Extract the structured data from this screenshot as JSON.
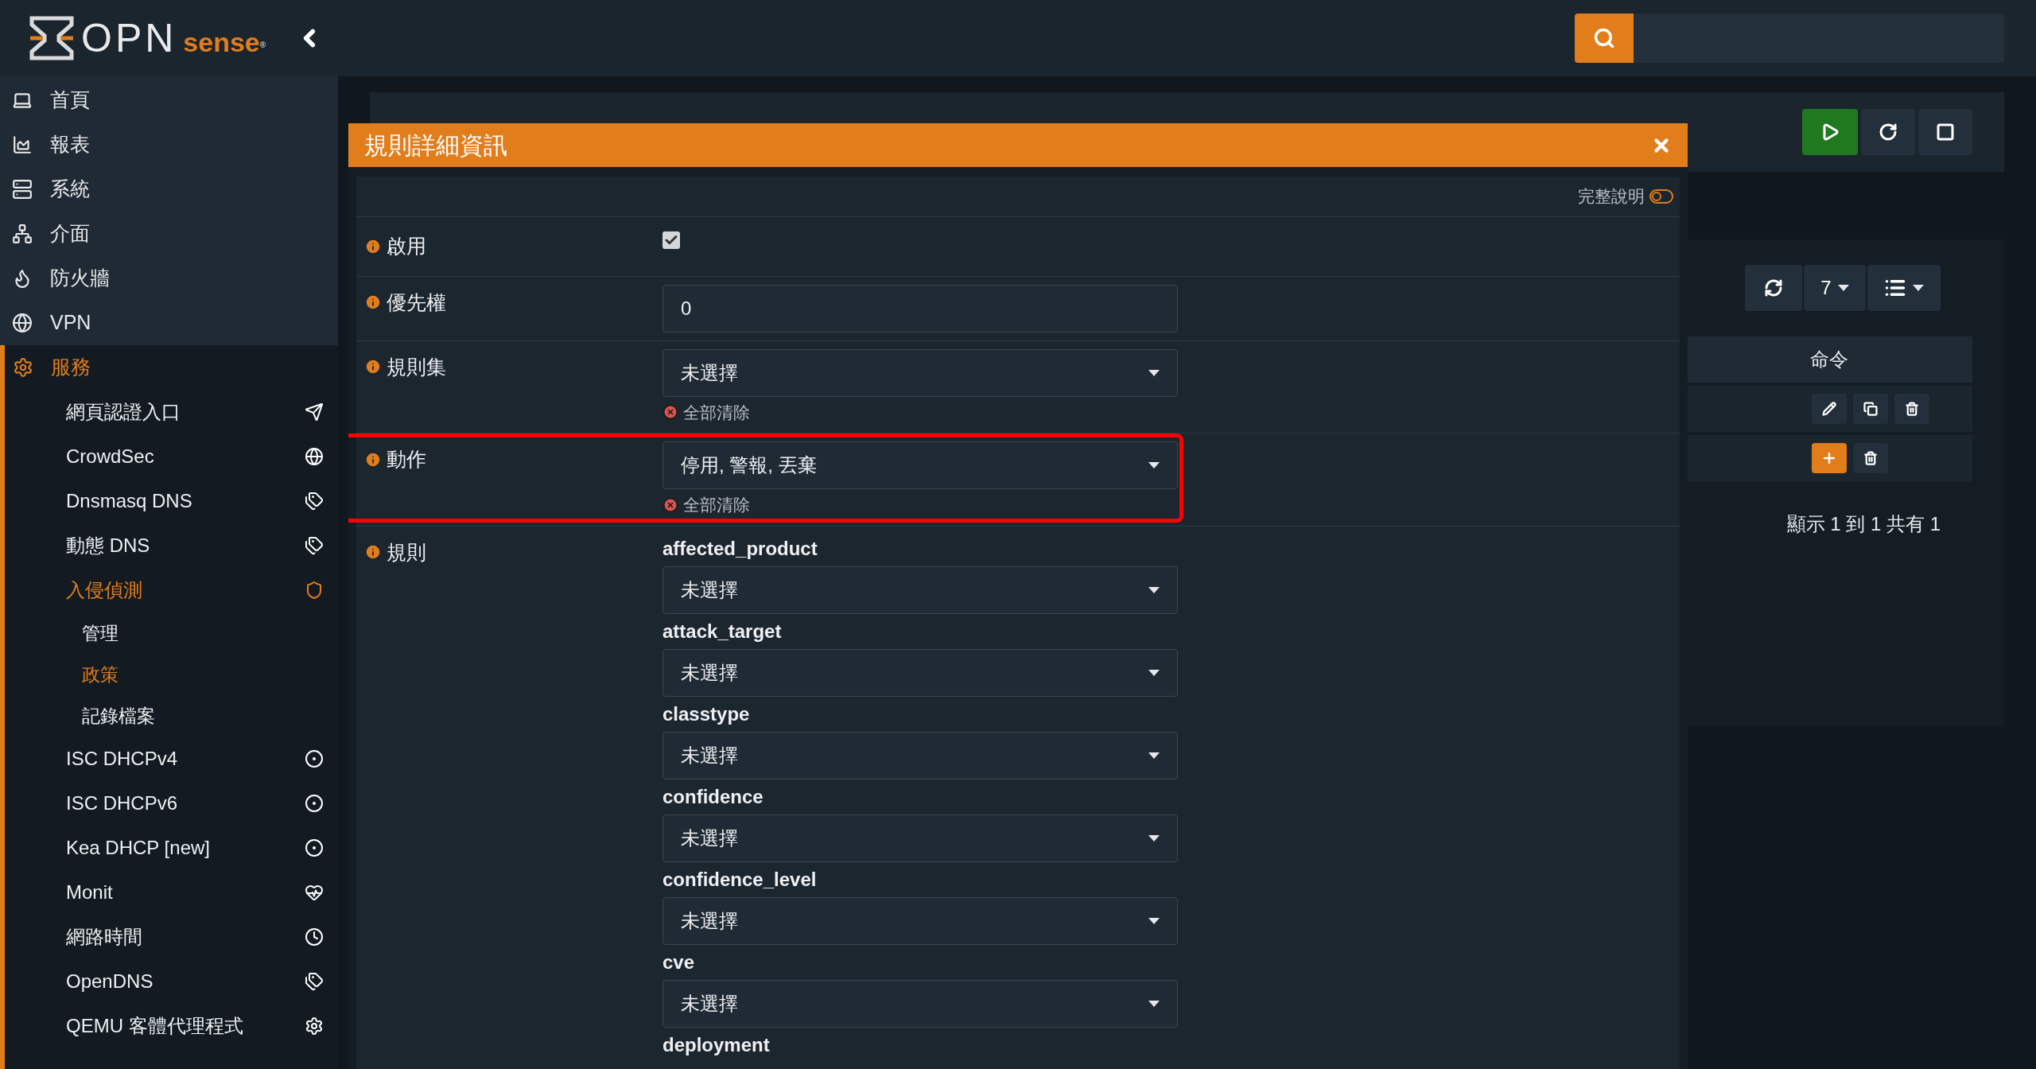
{
  "header": {
    "logo": {
      "main": "OPN",
      "accent": "sense",
      "mark": "®"
    }
  },
  "sidebar": {
    "items": [
      {
        "label": "首頁",
        "selected": false
      },
      {
        "label": "報表",
        "selected": false
      },
      {
        "label": "系統",
        "selected": false
      },
      {
        "label": "介面",
        "selected": false
      },
      {
        "label": "防火牆",
        "selected": false
      },
      {
        "label": "VPN",
        "selected": false
      },
      {
        "label": "服務",
        "selected": true,
        "children": [
          {
            "label": "網頁認證入口",
            "selected": false
          },
          {
            "label": "CrowdSec",
            "selected": false
          },
          {
            "label": "Dnsmasq DNS",
            "selected": false
          },
          {
            "label": "動態 DNS",
            "selected": false
          },
          {
            "label": "入侵偵測",
            "selected": true,
            "children": [
              {
                "label": "管理",
                "selected": false
              },
              {
                "label": "政策",
                "selected": true
              },
              {
                "label": "記錄檔案",
                "selected": false
              }
            ]
          },
          {
            "label": "ISC DHCPv4",
            "selected": false
          },
          {
            "label": "ISC DHCPv6",
            "selected": false
          },
          {
            "label": "Kea DHCP [new]",
            "selected": false
          },
          {
            "label": "Monit",
            "selected": false
          },
          {
            "label": "網路時間",
            "selected": false
          },
          {
            "label": "OpenDNS",
            "selected": false
          },
          {
            "label": "QEMU 客體代理程式",
            "selected": false
          }
        ]
      }
    ]
  },
  "page": {
    "table": {
      "page_size": "7",
      "columns": [
        "命令"
      ],
      "rows": [
        {
          "kind": "edit"
        },
        {
          "kind": "add"
        }
      ],
      "footer": "顯示 1 到 1 共有 1"
    }
  },
  "dialog": {
    "title": "規則詳細資訊",
    "full_help": {
      "label": "完整說明",
      "on": false
    },
    "fields": [
      {
        "kind": "checkbox",
        "label": "啟用",
        "checked": true,
        "highlighted": false
      },
      {
        "kind": "text",
        "label": "優先權",
        "value": "0",
        "highlighted": false
      },
      {
        "kind": "select",
        "label": "規則集",
        "value": "未選擇",
        "clear": "全部清除",
        "highlighted": false
      },
      {
        "kind": "select",
        "label": "動作",
        "value": "停用, 警報, 丟棄",
        "clear": "全部清除",
        "highlighted": true
      },
      {
        "kind": "group",
        "label": "規則",
        "highlighted": false,
        "subfields": [
          {
            "label": "affected_product",
            "value": "未選擇"
          },
          {
            "label": "attack_target",
            "value": "未選擇"
          },
          {
            "label": "classtype",
            "value": "未選擇"
          },
          {
            "label": "confidence",
            "value": "未選擇"
          },
          {
            "label": "confidence_level",
            "value": "未選擇"
          },
          {
            "label": "cve",
            "value": "未選擇"
          },
          {
            "label": "deployment"
          }
        ]
      }
    ]
  }
}
